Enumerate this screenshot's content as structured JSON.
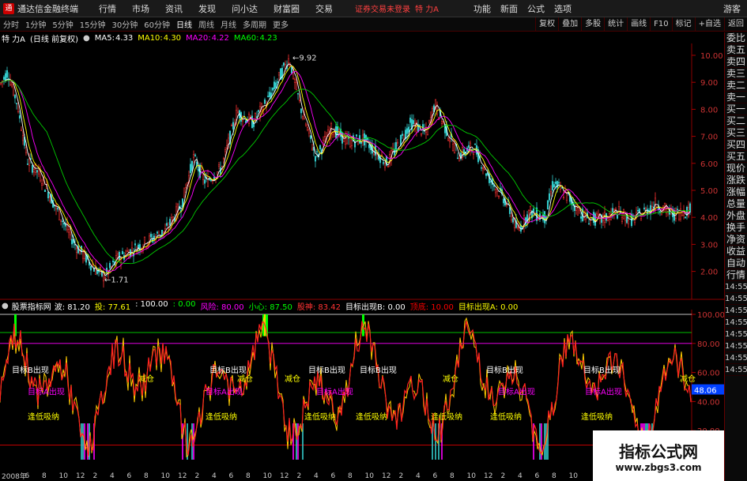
{
  "titlebar": {
    "app_title": "通达信金融终端",
    "menu": [
      "行情",
      "市场",
      "资讯",
      "发现",
      "问小达",
      "财富圈",
      "交易"
    ],
    "login_status": "证券交易未登录",
    "stock_title": "特 力A",
    "right_menu": [
      "功能",
      "新面",
      "公式",
      "选项"
    ],
    "guest": "游客"
  },
  "toolbar": {
    "periods": [
      "分时",
      "1分钟",
      "5分钟",
      "15分钟",
      "30分钟",
      "60分钟",
      "日线",
      "周线",
      "月线",
      "多周期",
      "更多"
    ],
    "active_period": "日线",
    "right_tools": [
      "复权",
      "叠加",
      "多股",
      "统计",
      "画线",
      "F10",
      "标记",
      "+自选",
      "返回"
    ]
  },
  "chart_header": {
    "name": "特 力A",
    "adjust": "(日线 前复权)",
    "ma5_label": "MA5:",
    "ma5": "4.33",
    "ma10_label": "MA10:",
    "ma10": "4.30",
    "ma20_label": "MA20:",
    "ma20": "4.22",
    "ma60_label": "MA60:",
    "ma60": "4.23"
  },
  "price_axis": [
    "10.00",
    "9.00",
    "8.00",
    "7.00",
    "6.00",
    "5.00",
    "4.00",
    "3.00",
    "2.00"
  ],
  "annotations": {
    "high": "9.92",
    "low": "1.71"
  },
  "indicator_header": {
    "name": "股票指标网",
    "items": [
      {
        "label": "波:",
        "value": "81.20",
        "color": "#ffffff"
      },
      {
        "label": "投:",
        "value": "77.61",
        "color": "#ffff00"
      },
      {
        "label": ":",
        "value": "100.00",
        "color": "#ffffff"
      },
      {
        "label": ":",
        "value": "0.00",
        "color": "#00ff00"
      },
      {
        "label": "风险:",
        "value": "80.00",
        "color": "#ff00ff"
      },
      {
        "label": "小心:",
        "value": "87.50",
        "color": "#00ff00"
      },
      {
        "label": "股神:",
        "value": "83.42",
        "color": "#ff3333"
      },
      {
        "label": "目标出现B:",
        "value": "0.00",
        "color": "#ffffff"
      },
      {
        "label": "顶底:",
        "value": "10.00",
        "color": "#ff0000"
      },
      {
        "label": "目标出现A:",
        "value": "0.00",
        "color": "#ffff00"
      }
    ]
  },
  "indicator_axis": [
    "100.00",
    "80.00",
    "60.00",
    "40.00",
    "20.00"
  ],
  "indicator_current": "48.06",
  "indicator_labels": [
    "目标B出现",
    "目标A出现",
    "逢低吸纳",
    "减仓"
  ],
  "sidebar": [
    "委比",
    "卖五",
    "卖四",
    "卖三",
    "卖二",
    "卖一",
    "买一",
    "买二",
    "买三",
    "买四",
    "买五",
    "现价",
    "涨跌",
    "涨幅",
    "总量",
    "外盘",
    "换手",
    "净资",
    "收益",
    "自动",
    "行情",
    "14:55",
    "14:55",
    "14:55",
    "14:55",
    "14:55",
    "14:55",
    "14:55",
    "14:55"
  ],
  "bottom_axis": [
    "2008年",
    "6",
    "8",
    "10",
    "12",
    "2",
    "4",
    "6",
    "8",
    "10",
    "12",
    "2",
    "4",
    "6",
    "8",
    "10",
    "12",
    "2",
    "4",
    "6",
    "8",
    "10",
    "12",
    "2",
    "4",
    "6",
    "8",
    "10",
    "12",
    "2",
    "4",
    "6",
    "8",
    "10"
  ],
  "watermark": {
    "title": "指标公式网",
    "url": "www.zbgs3.com"
  }
}
